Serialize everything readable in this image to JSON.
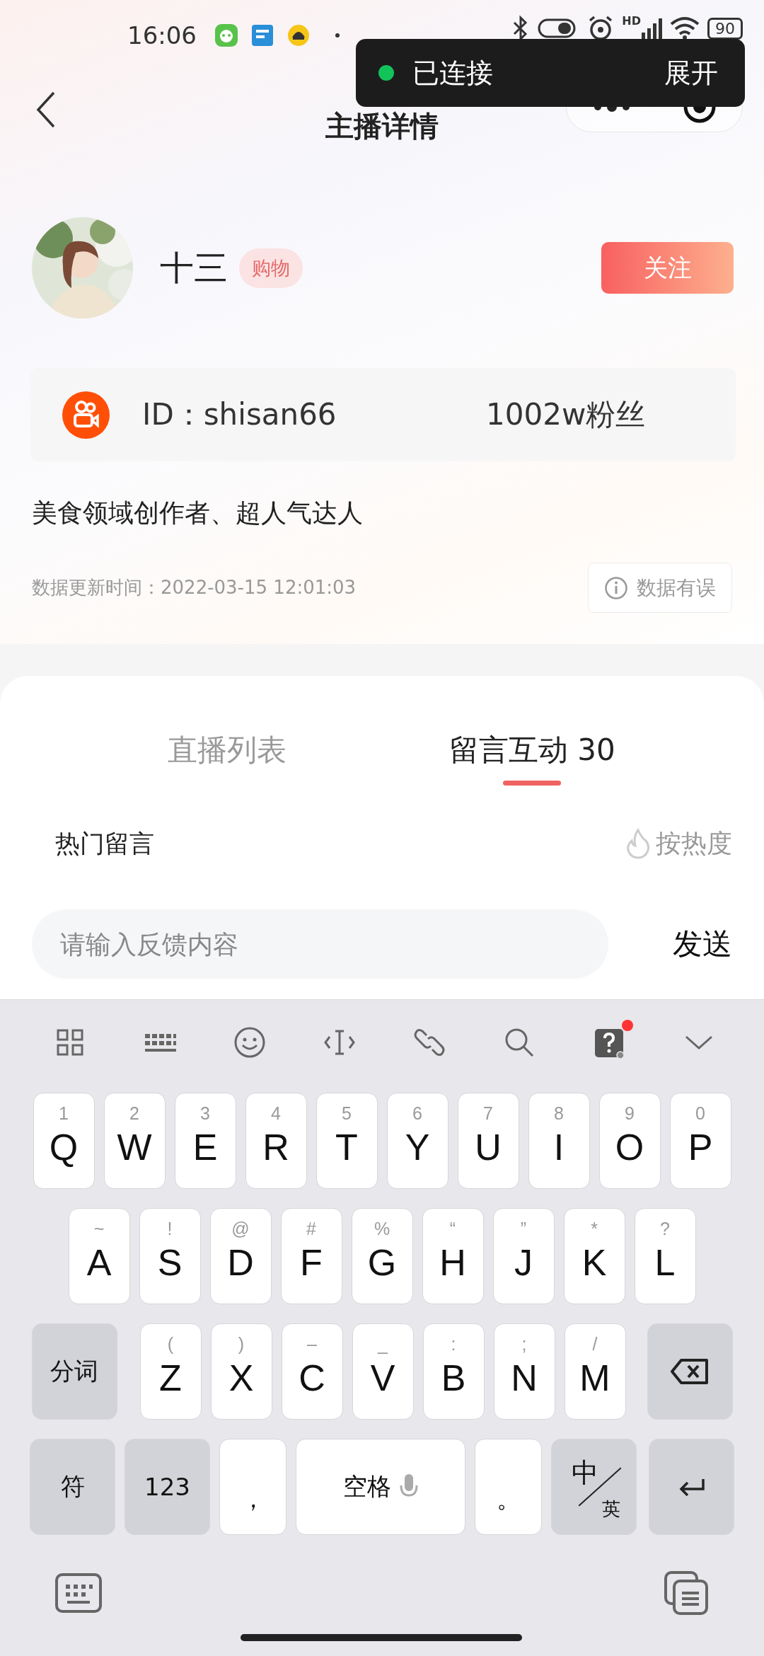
{
  "status_bar": {
    "time": "16:06",
    "hd_label": "HD",
    "battery": "90"
  },
  "toast": {
    "connected": true,
    "status": "已连接",
    "action": "展开"
  },
  "nav": {
    "title": "主播详情"
  },
  "profile": {
    "name": "十三",
    "tag": "购物",
    "follow_button": "关注",
    "id": "ID：shisan66",
    "fans": "1002w粉丝",
    "bio": "美食领域创作者、超人气达人",
    "update_time": "数据更新时间：2022-03-15 12:01:03",
    "report_button": "数据有误"
  },
  "tabs": [
    {
      "label": "直播列表",
      "selected": false
    },
    {
      "label": "留言互动 30",
      "selected": true
    }
  ],
  "comments": {
    "heading": "热门留言",
    "sort": "按热度"
  },
  "input": {
    "placeholder": "请输入反馈内容",
    "send": "发送"
  },
  "keyboard": {
    "toolbar": [
      {
        "kind": "grid"
      },
      {
        "kind": "keypad"
      },
      {
        "kind": "emoji"
      },
      {
        "kind": "cursor"
      },
      {
        "kind": "link"
      },
      {
        "kind": "search"
      },
      {
        "kind": "quiz",
        "badge": true
      },
      {
        "kind": "collapse"
      }
    ],
    "rows": [
      {
        "keys": [
          {
            "kind": "letter",
            "label": "Q",
            "hint": "1"
          },
          {
            "kind": "letter",
            "label": "W",
            "hint": "2"
          },
          {
            "kind": "letter",
            "label": "E",
            "hint": "3"
          },
          {
            "kind": "letter",
            "label": "R",
            "hint": "4"
          },
          {
            "kind": "letter",
            "label": "T",
            "hint": "5"
          },
          {
            "kind": "letter",
            "label": "Y",
            "hint": "6"
          },
          {
            "kind": "letter",
            "label": "U",
            "hint": "7"
          },
          {
            "kind": "letter",
            "label": "I",
            "hint": "8"
          },
          {
            "kind": "letter",
            "label": "O",
            "hint": "9"
          },
          {
            "kind": "letter",
            "label": "P",
            "hint": "0"
          }
        ]
      },
      {
        "keys": [
          {
            "kind": "letter",
            "label": "A",
            "hint": "~"
          },
          {
            "kind": "letter",
            "label": "S",
            "hint": "!"
          },
          {
            "kind": "letter",
            "label": "D",
            "hint": "@"
          },
          {
            "kind": "letter",
            "label": "F",
            "hint": "#"
          },
          {
            "kind": "letter",
            "label": "G",
            "hint": "%"
          },
          {
            "kind": "letter",
            "label": "H",
            "hint": "“"
          },
          {
            "kind": "letter",
            "label": "J",
            "hint": "”"
          },
          {
            "kind": "letter",
            "label": "K",
            "hint": "*"
          },
          {
            "kind": "letter",
            "label": "L",
            "hint": "?"
          }
        ]
      },
      {
        "keys": [
          {
            "kind": "function",
            "label": "分词"
          },
          {
            "kind": "letter",
            "label": "Z",
            "hint": "("
          },
          {
            "kind": "letter",
            "label": "X",
            "hint": ")"
          },
          {
            "kind": "letter",
            "label": "C",
            "hint": "–"
          },
          {
            "kind": "letter",
            "label": "V",
            "hint": "_"
          },
          {
            "kind": "letter",
            "label": "B",
            "hint": ":"
          },
          {
            "kind": "letter",
            "label": "N",
            "hint": ";"
          },
          {
            "kind": "letter",
            "label": "M",
            "hint": "/"
          },
          {
            "kind": "delete"
          }
        ]
      },
      {
        "keys": [
          {
            "kind": "function",
            "label": "符"
          },
          {
            "kind": "function",
            "label": "123"
          },
          {
            "kind": "punct",
            "label": "，"
          },
          {
            "kind": "space",
            "label": "空格"
          },
          {
            "kind": "punct",
            "label": "。"
          },
          {
            "kind": "lang",
            "label": "中",
            "sub": "英"
          },
          {
            "kind": "enter"
          }
        ]
      }
    ]
  }
}
